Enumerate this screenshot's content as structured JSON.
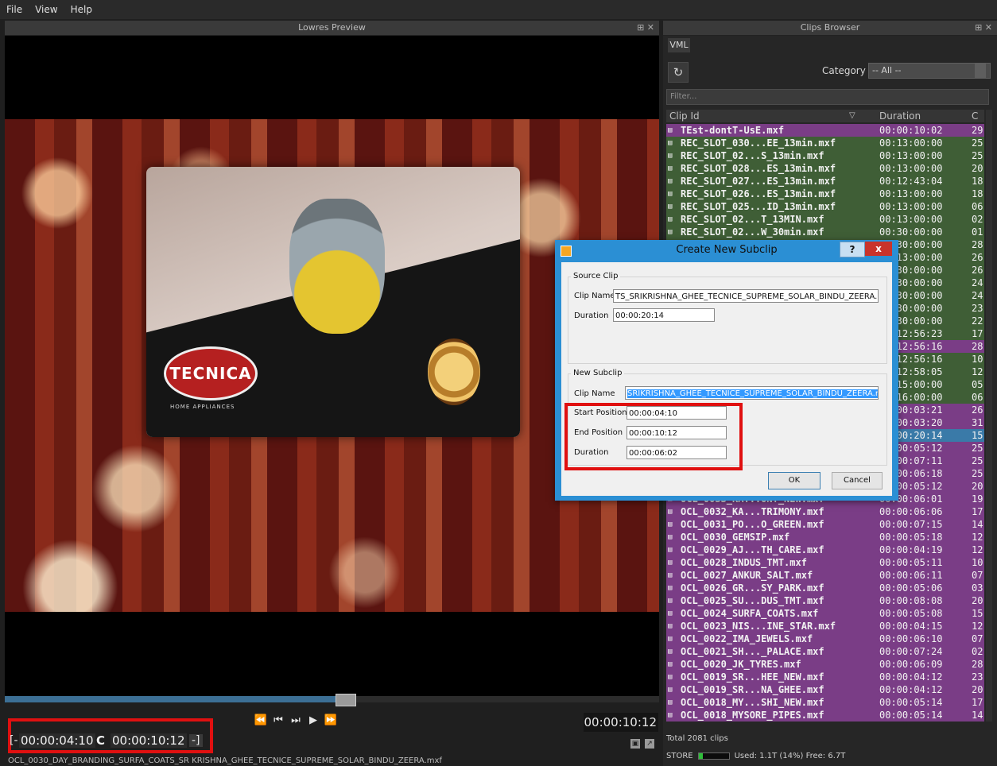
{
  "menu": [
    "File",
    "View",
    "Help"
  ],
  "preview": {
    "title": "Lowres Preview",
    "controls": "ਅ ✕",
    "logo_text": "TECNICA",
    "logo_sub": "HOME APPLIANCES",
    "scrub_progress": 0.52,
    "transport": [
      "⏪",
      "⏮",
      "⏭",
      "▶",
      "⏩"
    ],
    "current_tc": "00:00:10:12",
    "in_tc": "00:00:04:10",
    "out_tc": "00:00:10:12",
    "in_bracket": "[-",
    "out_bracket": "-]",
    "reset_glyph": "C",
    "filename": "OCL_0030_DAY_BRANDING_SURFA_COATS_SRIKRISHNA_GHEE_TECNICE_SUPREME_SOLAR_BINDU_ZEERA.mxf",
    "filename_visible": "OCL_0030_DAY_BRANDING_SURFA_COATS_SR KRISHNA_GHEE_TECNICE_SUPREME_SOLAR_BINDU_ZEERA.mxf"
  },
  "browser": {
    "title": "Clips Browser",
    "controls": "ਅ ✕",
    "tab": "VML",
    "category_label": "Category",
    "category_value": "-- All --",
    "filter_placeholder": "Filter...",
    "col_id": "Clip Id",
    "col_duration": "Duration",
    "col_c": "C",
    "total": "Total 2081 clips",
    "store_label": "STORE",
    "store_fill": 0.14,
    "store_text": "Used: 1.1T (14%)  Free: 6.7T",
    "colors": {
      "purple": "#7a3d86",
      "green": "#3f5e36",
      "selected": "#3a7aa8"
    },
    "rows": [
      {
        "id": "TEst-dontT-UsE.mxf",
        "dur": "00:00:10:02",
        "c": "29",
        "color": "purple"
      },
      {
        "id": "REC_SLOT_030...EE_13min.mxf",
        "dur": "00:13:00:00",
        "c": "25",
        "color": "green"
      },
      {
        "id": "REC_SLOT_02...S_13min.mxf",
        "dur": "00:13:00:00",
        "c": "25",
        "color": "green"
      },
      {
        "id": "REC_SLOT_028...ES_13min.mxf",
        "dur": "00:13:00:00",
        "c": "20",
        "color": "green"
      },
      {
        "id": "REC_SLOT_027...ES_13min.mxf",
        "dur": "00:12:43:04",
        "c": "18",
        "color": "green"
      },
      {
        "id": "REC_SLOT_026...ES_13min.mxf",
        "dur": "00:13:00:00",
        "c": "18",
        "color": "green"
      },
      {
        "id": "REC_SLOT_025...ID_13min.mxf",
        "dur": "00:13:00:00",
        "c": "06",
        "color": "green"
      },
      {
        "id": "REC_SLOT_02...T_13MIN.mxf",
        "dur": "00:13:00:00",
        "c": "02",
        "color": "green"
      },
      {
        "id": "REC_SLOT_02...W_30min.mxf",
        "dur": "00:30:00:00",
        "c": "01",
        "color": "green"
      },
      {
        "id": "",
        "dur": "00:30:00:00",
        "c": "28",
        "color": "green"
      },
      {
        "id": "",
        "dur": "00:13:00:00",
        "c": "26",
        "color": "green"
      },
      {
        "id": "",
        "dur": "00:30:00:00",
        "c": "26",
        "color": "green"
      },
      {
        "id": "",
        "dur": "00:30:00:00",
        "c": "24",
        "color": "green"
      },
      {
        "id": "",
        "dur": "00:30:00:00",
        "c": "24",
        "color": "green"
      },
      {
        "id": "",
        "dur": "00:30:00:00",
        "c": "23",
        "color": "green"
      },
      {
        "id": "",
        "dur": "00:30:00:00",
        "c": "22",
        "color": "green"
      },
      {
        "id": "",
        "dur": "00:12:56:23",
        "c": "17",
        "color": "green"
      },
      {
        "id": "",
        "dur": "00:12:56:16",
        "c": "28",
        "color": "purple"
      },
      {
        "id": "",
        "dur": "00:12:56:16",
        "c": "10",
        "color": "green"
      },
      {
        "id": "",
        "dur": "00:12:58:05",
        "c": "12",
        "color": "green"
      },
      {
        "id": "",
        "dur": "00:15:00:00",
        "c": "05",
        "color": "green"
      },
      {
        "id": "",
        "dur": "00:16:00:00",
        "c": "06",
        "color": "green"
      },
      {
        "id": "",
        "dur": "00:00:03:21",
        "c": "26",
        "color": "purple"
      },
      {
        "id": "",
        "dur": "00:00:03:20",
        "c": "31",
        "color": "purple"
      },
      {
        "id": "",
        "dur": "00:00:20:14",
        "c": "15",
        "color": "selected"
      },
      {
        "id": "",
        "dur": "00:00:05:12",
        "c": "25",
        "color": "purple"
      },
      {
        "id": "",
        "dur": "00:00:07:11",
        "c": "25",
        "color": "purple"
      },
      {
        "id": "",
        "dur": "00:00:06:18",
        "c": "25",
        "color": "purple"
      },
      {
        "id": "",
        "dur": "00:00:05:12",
        "c": "20",
        "color": "purple"
      },
      {
        "id": "OCL_0033_KA...ONT_NEW.mxf",
        "dur": "00:00:06:01",
        "c": "19",
        "color": "purple"
      },
      {
        "id": "OCL_0032_KA...TRIMONY.mxf",
        "dur": "00:00:06:06",
        "c": "17",
        "color": "purple"
      },
      {
        "id": "OCL_0031_PO...O_GREEN.mxf",
        "dur": "00:00:07:15",
        "c": "14",
        "color": "purple"
      },
      {
        "id": "OCL_0030_GEMSIP.mxf",
        "dur": "00:00:05:18",
        "c": "12",
        "color": "purple"
      },
      {
        "id": "OCL_0029_AJ...TH_CARE.mxf",
        "dur": "00:00:04:19",
        "c": "12",
        "color": "purple"
      },
      {
        "id": "OCL_0028_INDUS_TMT.mxf",
        "dur": "00:00:05:11",
        "c": "10",
        "color": "purple"
      },
      {
        "id": "OCL_0027_ANKUR_SALT.mxf",
        "dur": "00:00:06:11",
        "c": "07",
        "color": "purple"
      },
      {
        "id": "OCL_0026_GR...SY_PARK.mxf",
        "dur": "00:00:05:06",
        "c": "03",
        "color": "purple"
      },
      {
        "id": "OCL_0025_SU...DUS_TMT.mxf",
        "dur": "00:00:08:08",
        "c": "20",
        "color": "purple"
      },
      {
        "id": "OCL_0024_SURFA_COATS.mxf",
        "dur": "00:00:05:08",
        "c": "15",
        "color": "purple"
      },
      {
        "id": "OCL_0023_NIS...INE_STAR.mxf",
        "dur": "00:00:04:15",
        "c": "12",
        "color": "purple"
      },
      {
        "id": "OCL_0022_IMA_JEWELS.mxf",
        "dur": "00:00:06:10",
        "c": "07",
        "color": "purple"
      },
      {
        "id": "OCL_0021_SH..._PALACE.mxf",
        "dur": "00:00:07:24",
        "c": "02",
        "color": "purple"
      },
      {
        "id": "OCL_0020_JK_TYRES.mxf",
        "dur": "00:00:06:09",
        "c": "28",
        "color": "purple"
      },
      {
        "id": "OCL_0019_SR...HEE_NEW.mxf",
        "dur": "00:00:04:12",
        "c": "23",
        "color": "purple"
      },
      {
        "id": "OCL_0019_SR...NA_GHEE.mxf",
        "dur": "00:00:04:12",
        "c": "20",
        "color": "purple"
      },
      {
        "id": "OCL_0018_MY...SHI_NEW.mxf",
        "dur": "00:00:05:14",
        "c": "17",
        "color": "purple"
      },
      {
        "id": "OCL_0018_MYSORE_PIPES.mxf",
        "dur": "00:00:05:14",
        "c": "14",
        "color": "purple"
      }
    ]
  },
  "dialog": {
    "title": "Create New Subclip",
    "help": "?",
    "close": "x",
    "source_group": "Source Clip",
    "src_name_label": "Clip Name",
    "src_name_value": "TS_SRIKRISHNA_GHEE_TECNICE_SUPREME_SOLAR_BINDU_ZEERA.mxf",
    "src_dur_label": "Duration",
    "src_dur_value": "00:00:20:14",
    "new_group": "New Subclip",
    "new_name_label": "Clip Name",
    "new_name_value": "SRIKRISHNA_GHEE_TECNICE_SUPREME_SOLAR_BINDU_ZEERA.mxf",
    "start_label": "Start Position",
    "start_value": "00:00:04:10",
    "end_label": "End Position",
    "end_value": "00:00:10:12",
    "dur_label": "Duration",
    "dur_value": "00:00:06:02",
    "ok": "OK",
    "cancel": "Cancel"
  }
}
